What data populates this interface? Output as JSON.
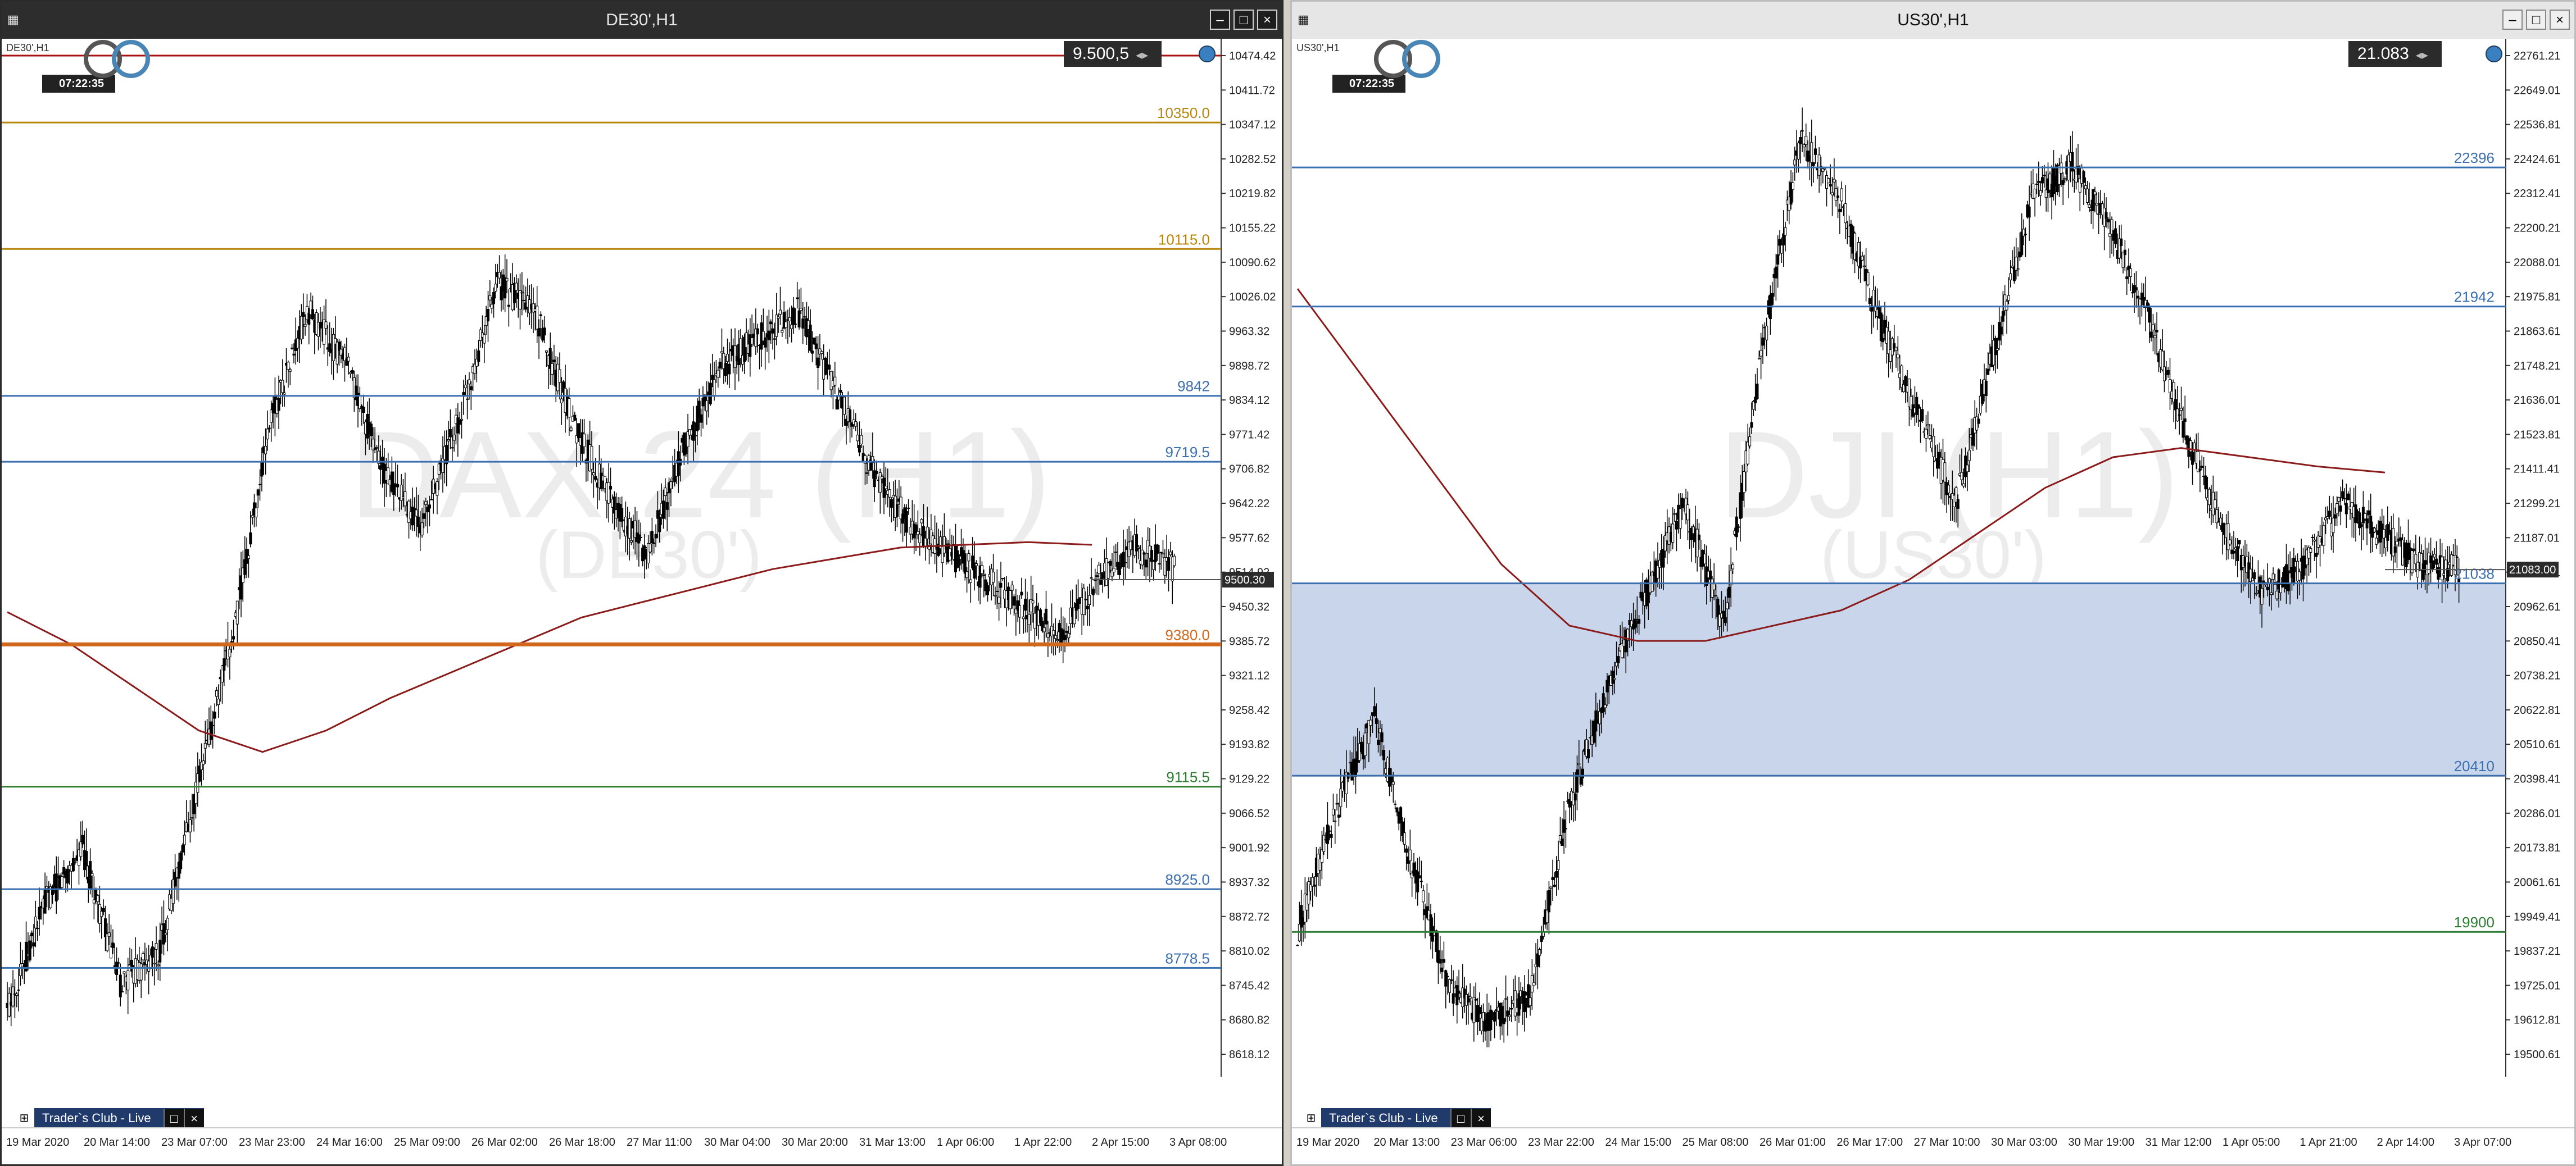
{
  "left": {
    "title": "DE30',H1",
    "symbol_label": "DE30',H1",
    "price_box": "9.500,5",
    "clock": "07:22:35",
    "watermark": "DAX 24 (H1)",
    "watermark_sub": "(DE30')",
    "taskbar_label": "Trader`s Club - Live",
    "price_ticks": [
      "10474.42",
      "10411.72",
      "10347.12",
      "10282.52",
      "10219.82",
      "10155.22",
      "10090.62",
      "10026.02",
      "9963.32",
      "9898.72",
      "9834.12",
      "9771.42",
      "9706.82",
      "9642.22",
      "9577.62",
      "9514.92",
      "9450.32",
      "9385.72",
      "9321.12",
      "9258.42",
      "9193.82",
      "9129.22",
      "9066.52",
      "9001.92",
      "8937.32",
      "8872.72",
      "8810.02",
      "8745.42",
      "8680.82",
      "8618.12"
    ],
    "time_ticks": [
      "19 Mar 2020",
      "20 Mar 14:00",
      "23 Mar 07:00",
      "23 Mar 23:00",
      "24 Mar 16:00",
      "25 Mar 09:00",
      "26 Mar 02:00",
      "26 Mar 18:00",
      "27 Mar 11:00",
      "30 Mar 04:00",
      "30 Mar 20:00",
      "31 Mar 13:00",
      "1 Apr 06:00",
      "1 Apr 22:00",
      "2 Apr 15:00",
      "3 Apr 08:00"
    ],
    "levels": [
      {
        "label": "10350.0",
        "price": 10350,
        "color": "#b8860b"
      },
      {
        "label": "10115.0",
        "price": 10115,
        "color": "#b8860b"
      },
      {
        "label": "9842",
        "price": 9842,
        "color": "#3b6fb0"
      },
      {
        "label": "9719.5",
        "price": 9719.5,
        "color": "#3b6fb0"
      },
      {
        "label": "9380.0",
        "price": 9380,
        "color": "#d2691e"
      },
      {
        "label": "9115.5",
        "price": 9115.5,
        "color": "#2e7d32"
      },
      {
        "label": "8925.0",
        "price": 8925,
        "color": "#3b6fb0"
      },
      {
        "label": "8778.5",
        "price": 8778.5,
        "color": "#3b6fb0"
      }
    ],
    "current_price": "9500.30",
    "current_price_value": 9500.3,
    "top_line_price": 10474.42,
    "price_min": 8618.12,
    "price_max": 10474.42
  },
  "right": {
    "title": "US30',H1",
    "symbol_label": "US30',H1",
    "price_box": "21.083",
    "clock": "07:22:35",
    "watermark": "DJI (H1)",
    "watermark_sub": "(US30')",
    "taskbar_label": "Trader`s Club - Live",
    "price_ticks": [
      "22761.21",
      "22649.01",
      "22536.81",
      "22424.61",
      "22312.41",
      "22200.21",
      "22088.01",
      "21975.81",
      "21863.61",
      "21748.21",
      "21636.01",
      "21523.81",
      "21411.41",
      "21299.21",
      "21187.01",
      "21074.81",
      "20962.61",
      "20850.41",
      "20738.21",
      "20622.81",
      "20510.61",
      "20398.41",
      "20286.01",
      "20173.81",
      "20061.61",
      "19949.41",
      "19837.21",
      "19725.01",
      "19612.81",
      "19500.61"
    ],
    "time_ticks": [
      "19 Mar 2020",
      "20 Mar 13:00",
      "23 Mar 06:00",
      "23 Mar 22:00",
      "24 Mar 15:00",
      "25 Mar 08:00",
      "26 Mar 01:00",
      "26 Mar 17:00",
      "27 Mar 10:00",
      "30 Mar 03:00",
      "30 Mar 19:00",
      "31 Mar 12:00",
      "1 Apr 05:00",
      "1 Apr 21:00",
      "2 Apr 14:00",
      "3 Apr 07:00"
    ],
    "levels": [
      {
        "label": "22396",
        "price": 22396,
        "color": "#3b6fb0"
      },
      {
        "label": "21942",
        "price": 21942,
        "color": "#3b6fb0"
      },
      {
        "label": "21038",
        "price": 21038,
        "color": "#3b6fb0"
      },
      {
        "label": "20410",
        "price": 20410,
        "color": "#3b6fb0"
      },
      {
        "label": "19900",
        "price": 19900,
        "color": "#2e7d32"
      }
    ],
    "current_price": "21083.00",
    "current_price_value": 21083,
    "zone": {
      "from": 20410,
      "to": 21038,
      "color": "#c9d5ea"
    },
    "price_min": 19500.61,
    "price_max": 22761.21
  },
  "colors": {
    "ma": "#8b1a1a",
    "candle": "#000000"
  }
}
